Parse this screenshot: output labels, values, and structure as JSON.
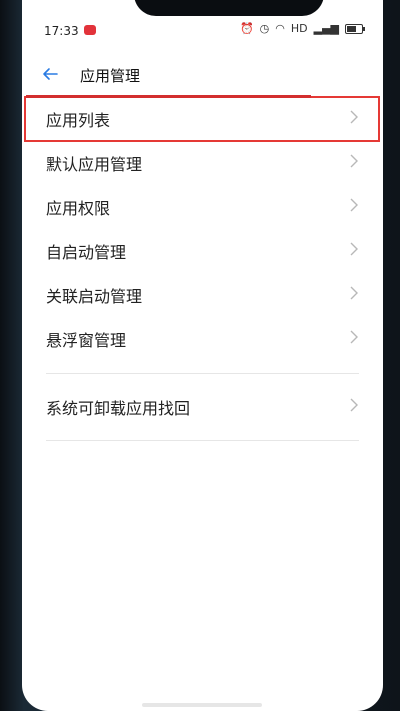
{
  "status": {
    "time": "17:33",
    "network_label": "HD",
    "icons": [
      "notification-badge-icon",
      "alarm-icon",
      "clock-icon",
      "wifi-icon",
      "signal-icon",
      "battery-icon"
    ]
  },
  "header": {
    "title": "应用管理",
    "back_icon": "arrow-left-icon"
  },
  "list": {
    "items": [
      {
        "label": "应用列表",
        "highlighted": true
      },
      {
        "label": "默认应用管理"
      },
      {
        "label": "应用权限"
      },
      {
        "label": "自启动管理"
      },
      {
        "label": "关联启动管理"
      },
      {
        "label": "悬浮窗管理"
      },
      {
        "label": "系统可卸载应用找回"
      }
    ]
  },
  "colors": {
    "accent_blue": "#2a7be3",
    "highlight_red": "#e53935",
    "text": "#222222",
    "chevron": "#b8b8b8"
  }
}
